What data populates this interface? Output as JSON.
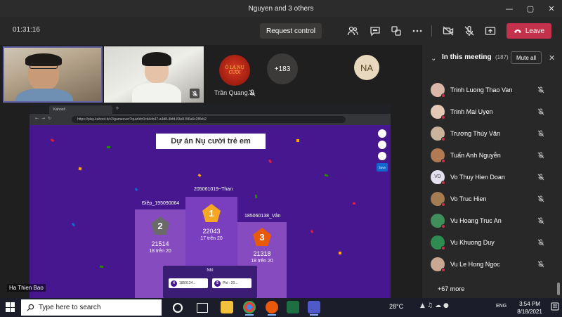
{
  "window": {
    "title": "Nguyen and 3 others"
  },
  "toolbar": {
    "timer": "01:31:16",
    "request_control": "Request control",
    "leave": "Leave"
  },
  "participants": {
    "tile_tq_name": "Trần Quang...",
    "overflow_count": "+183",
    "initials": "NA",
    "logo_text": "Ô LÀ NỤ CƯỜI"
  },
  "share": {
    "presenter": "Ha Thien Bao",
    "browser_tab": "Kahoot!",
    "url": "https://play.kahoot.it/v2/gameover?quizId=0cb4cb47-a4d8-4bfd-83e8-5f6a6c2f8cb2",
    "quiz_title": "Dự án Nụ cười trẻ em",
    "side_ctl": "Save",
    "podium": [
      {
        "rank": "2",
        "name": "Điệp_195090064",
        "score": "21514",
        "sub": "18 trên 20",
        "color": "#6a6a6a"
      },
      {
        "rank": "1",
        "name": "205061019~Than",
        "score": "22043",
        "sub": "17 trên 20",
        "color": "#f5a623"
      },
      {
        "rank": "3",
        "name": "185060138_Vân",
        "score": "21318",
        "sub": "18 trên 20",
        "color": "#e8590c"
      }
    ],
    "nhi": {
      "title": "Nhì",
      "items": [
        {
          "num": "4",
          "label": "1850124..."
        },
        {
          "num": "5",
          "label": "Phi - 20..."
        }
      ]
    }
  },
  "panel": {
    "title": "In this meeting",
    "count": "(187)",
    "mute_all": "Mute all",
    "people": [
      {
        "name": "Trinh Luong Thao Van",
        "initials": "",
        "color": "#d9b8a8"
      },
      {
        "name": "Trinh Mai Uyen",
        "initials": "",
        "color": "#e6c9b5"
      },
      {
        "name": "Trương Thúy Vân",
        "initials": "",
        "color": "#cbb49c"
      },
      {
        "name": "Tuấn Anh Nguyễn",
        "initials": "",
        "color": "#b07a52"
      },
      {
        "name": "Vo Thuy Hien Doan",
        "initials": "VD",
        "color": "#e6e1ee"
      },
      {
        "name": "Vo Truc Hien",
        "initials": "",
        "color": "#a57b52"
      },
      {
        "name": "Vu Hoang Truc An",
        "initials": "",
        "color": "#3f8f5a"
      },
      {
        "name": "Vu Khuong Duy",
        "initials": "",
        "color": "#2f8c4f"
      },
      {
        "name": "Vu Le Hong Ngoc",
        "initials": "",
        "color": "#c8a892"
      }
    ],
    "more": "+67 more"
  },
  "taskbar": {
    "search_placeholder": "Type here to search",
    "temp": "28°C",
    "lang": "ENG",
    "time": "3:54 PM",
    "date": "8/18/2021"
  }
}
